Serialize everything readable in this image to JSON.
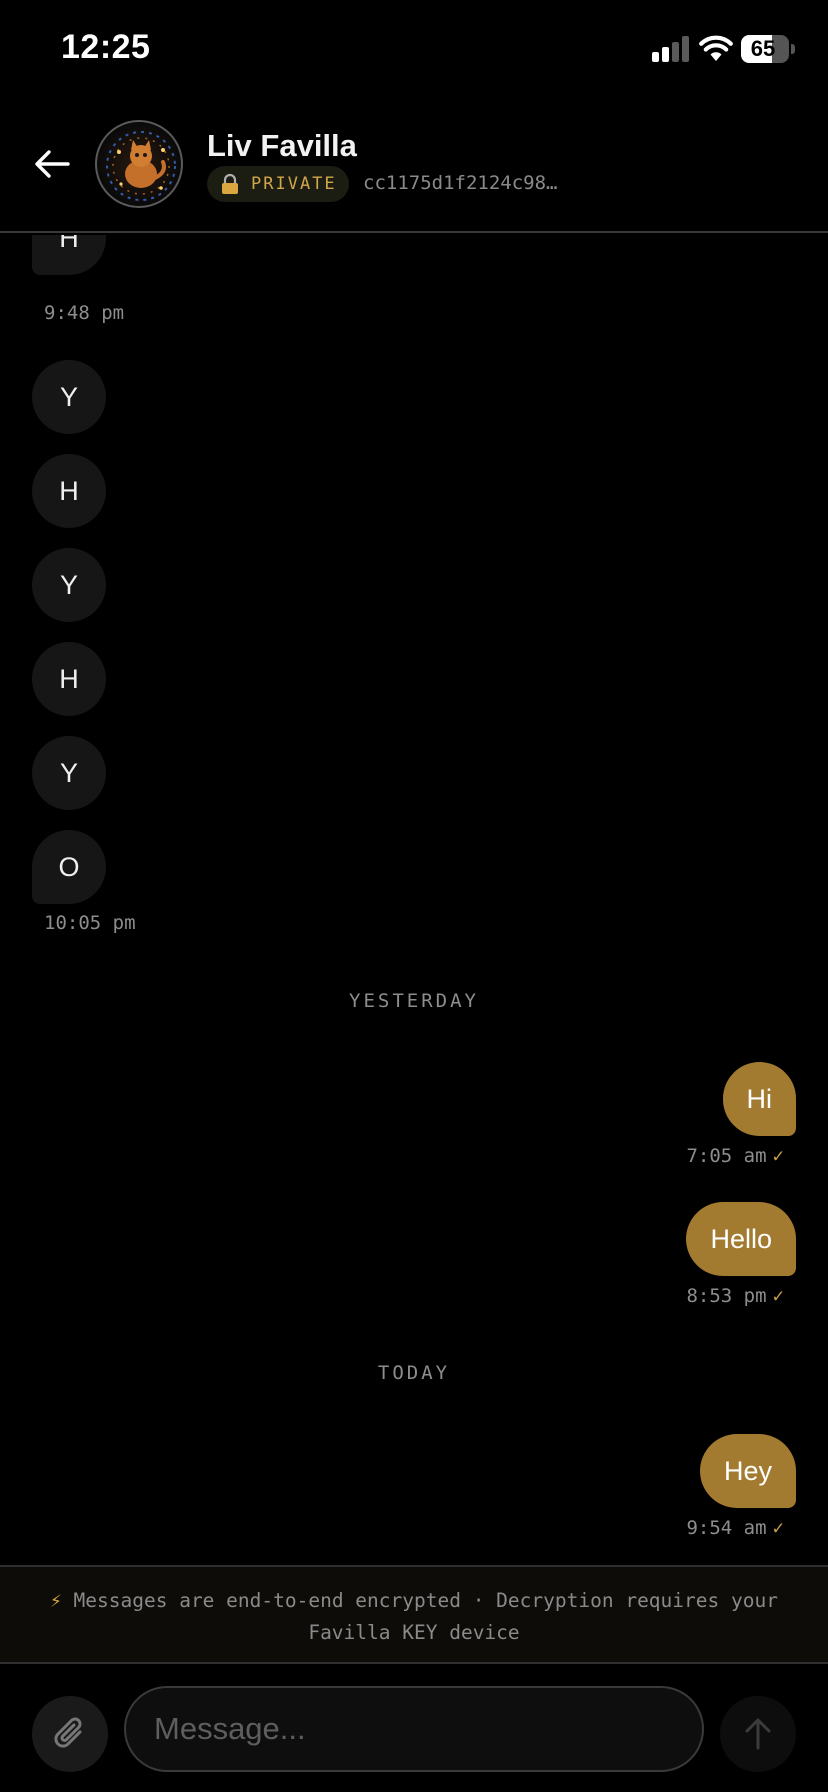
{
  "status_bar": {
    "time": "12:25",
    "battery_level": 65,
    "battery_text": "65",
    "signal_bars_active": 2,
    "signal_bars_total": 4
  },
  "header": {
    "contact_name": "Liv Favilla",
    "private_label": "PRIVATE",
    "contact_key": "cc1175d1f2124c98…",
    "accent_color": "#d2a64a"
  },
  "messages": {
    "incoming": [
      {
        "text": "H"
      },
      {
        "text": "Y"
      },
      {
        "text": "H"
      },
      {
        "text": "Y"
      },
      {
        "text": "H"
      },
      {
        "text": "Y"
      },
      {
        "text": "O"
      }
    ],
    "incoming_times": [
      "9:48 pm",
      "10:05 pm"
    ],
    "separators": [
      "YESTERDAY",
      "TODAY"
    ],
    "outgoing": [
      {
        "text": "Hi",
        "time": "7:05 am",
        "check": "✓"
      },
      {
        "text": "Hello",
        "time": "8:53 pm",
        "check": "✓"
      },
      {
        "text": "Hey",
        "time": "9:54 am",
        "check": "✓"
      }
    ],
    "outgoing_bubble_color": "#a27a30",
    "incoming_bubble_color": "#161616"
  },
  "notice": {
    "icon": "⚡",
    "text": "Messages are end-to-end encrypted · Decryption requires your Favilla KEY device"
  },
  "composer": {
    "placeholder": "Message...",
    "value": ""
  },
  "icons": {
    "back": "arrow-left-icon",
    "lock": "lock-icon",
    "attach": "paperclip-icon",
    "send": "arrow-up-icon"
  }
}
